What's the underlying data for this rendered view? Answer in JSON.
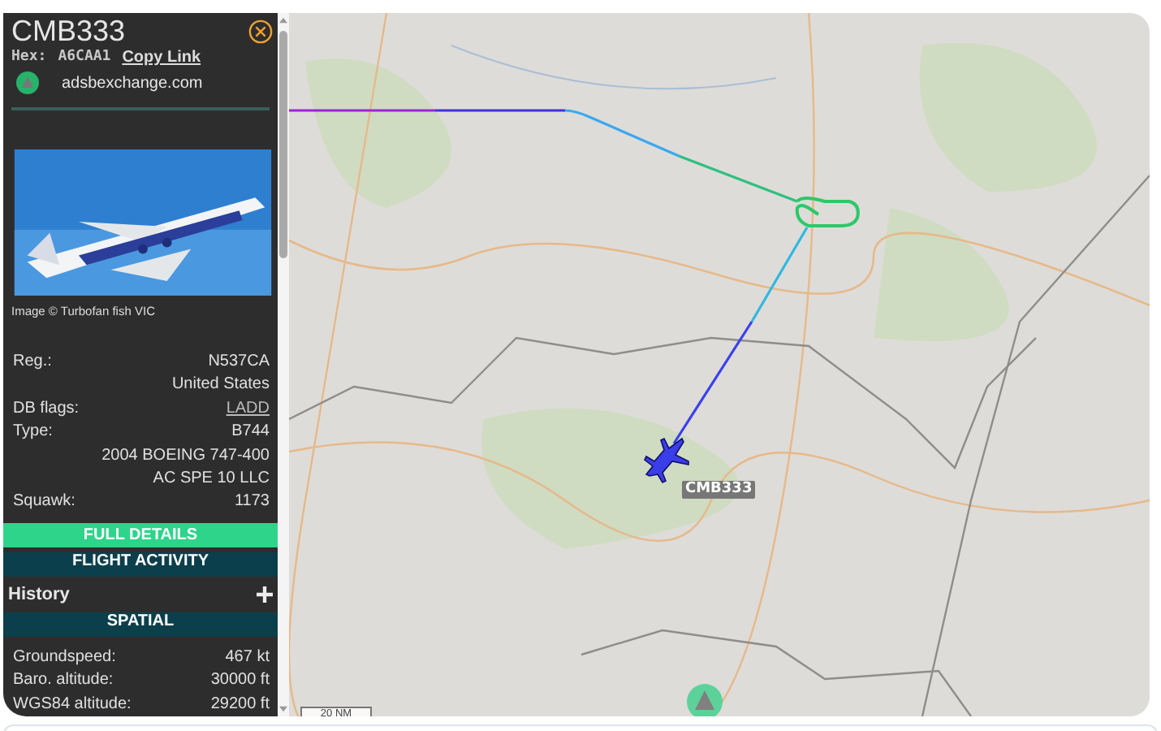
{
  "header": {
    "callsign": "CMB333",
    "hex_label": "Hex:",
    "hex": "A6CAA1",
    "copy_link": "Copy Link",
    "site": "adsbexchange.com"
  },
  "photo": {
    "kind": "picture",
    "caption": "Image © Turbofan fish VIC"
  },
  "details": [
    {
      "label": "Reg.:",
      "value": "N537CA",
      "link": false
    },
    {
      "value": "United States",
      "link": false
    },
    {
      "label": "DB flags:",
      "value": "LADD",
      "link": true
    },
    {
      "label": "Type:",
      "value": "B744",
      "link": false
    },
    {
      "value": "2004 BOEING 747-400",
      "link": false
    },
    {
      "value": "AC SPE 10 LLC",
      "link": false
    },
    {
      "label": "Squawk:",
      "value": "1173",
      "link": false
    }
  ],
  "sections": [
    {
      "kind": "button",
      "label": "FULL DETAILS"
    },
    {
      "kind": "header",
      "label": "FLIGHT ACTIVITY"
    },
    {
      "kind": "collapsible",
      "label": "History",
      "expanded": false
    },
    {
      "kind": "header",
      "label": "SPATIAL"
    }
  ],
  "spatial": [
    {
      "label": "Groundspeed:",
      "value": "467 kt"
    },
    {
      "label": "Baro. altitude:",
      "value": "30000 ft"
    },
    {
      "label": "WGS84 altitude:",
      "value": "29200 ft"
    }
  ],
  "map": {
    "callsign": "CMB333",
    "scale": "20 NM"
  }
}
